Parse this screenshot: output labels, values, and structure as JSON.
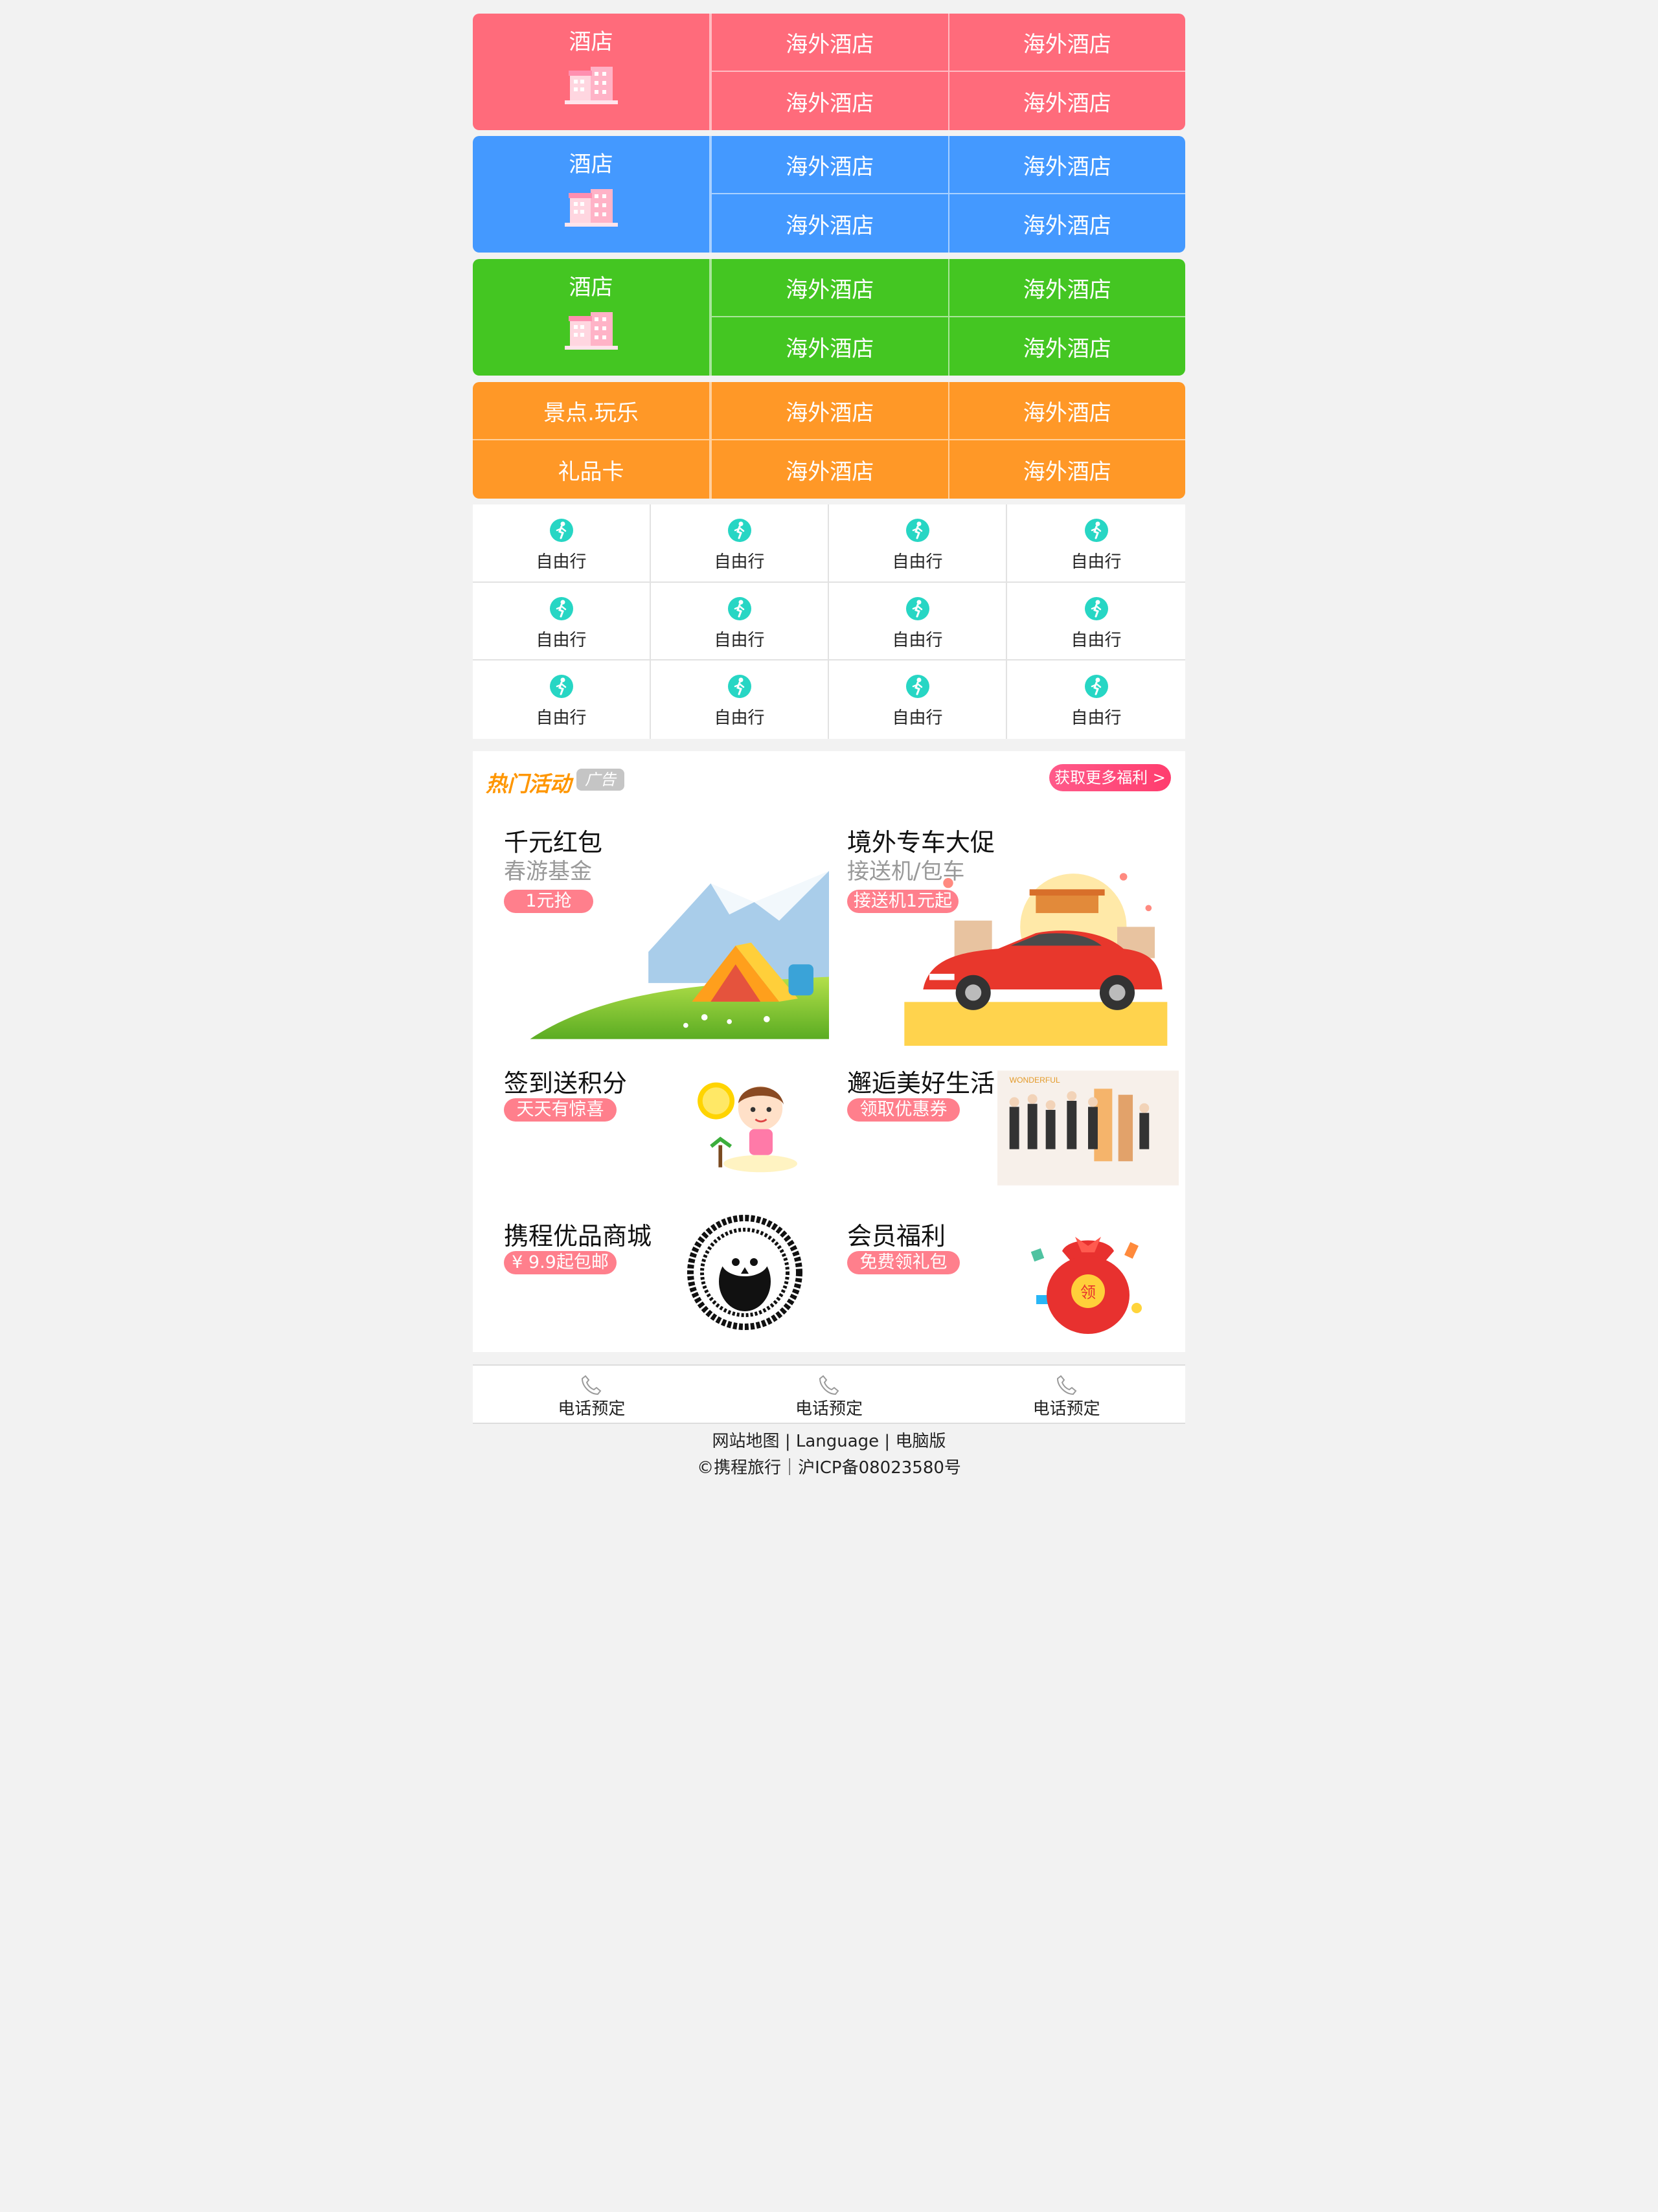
{
  "categories": [
    {
      "main": "酒店",
      "color": "#ff6b7b",
      "cells": [
        "海外酒店",
        "海外酒店",
        "海外酒店",
        "海外酒店"
      ]
    },
    {
      "main": "酒店",
      "color": "#4499ff",
      "cells": [
        "海外酒店",
        "海外酒店",
        "海外酒店",
        "海外酒店"
      ]
    },
    {
      "main": "酒店",
      "color": "#44c622",
      "cells": [
        "海外酒店",
        "海外酒店",
        "海外酒店",
        "海外酒店"
      ]
    }
  ],
  "orange": {
    "color": "#ff9827",
    "left_top": "景点.玩乐",
    "left_bottom": "礼品卡",
    "cells": [
      "海外酒店",
      "海外酒店",
      "海外酒店",
      "海外酒店"
    ]
  },
  "icon_grid": {
    "icon": "free-travel-icon",
    "label": "自由行",
    "items": [
      "自由行",
      "自由行",
      "自由行",
      "自由行",
      "自由行",
      "自由行",
      "自由行",
      "自由行",
      "自由行",
      "自由行",
      "自由行",
      "自由行"
    ]
  },
  "promo": {
    "title": "热门活动",
    "ad_tag": "广告",
    "more": "获取更多福利 >",
    "tiles": [
      {
        "title": "千元红包",
        "sub": "春游基金",
        "pill": "1元抢"
      },
      {
        "title": "境外专车大促",
        "sub": "接送机/包车",
        "pill": "接送机1元起"
      },
      {
        "title": "签到送积分",
        "pill": "天天有惊喜"
      },
      {
        "title": "邂逅美好生活",
        "pill": "领取优惠券"
      },
      {
        "title": "携程优品商城",
        "pill": "¥ 9.9起包邮"
      },
      {
        "title": "会员福利",
        "pill": "免费领礼包"
      }
    ],
    "badge_text": "领",
    "poster_text": "WONDERFUL"
  },
  "phone_bar": {
    "items": [
      "电话预定",
      "电话预定",
      "电话预定"
    ]
  },
  "footer": {
    "link1": "网站地图",
    "sep": "|",
    "link2": "Language",
    "link3": "电脑版",
    "copyright": "©携程旅行｜沪ICP备08023580号"
  }
}
